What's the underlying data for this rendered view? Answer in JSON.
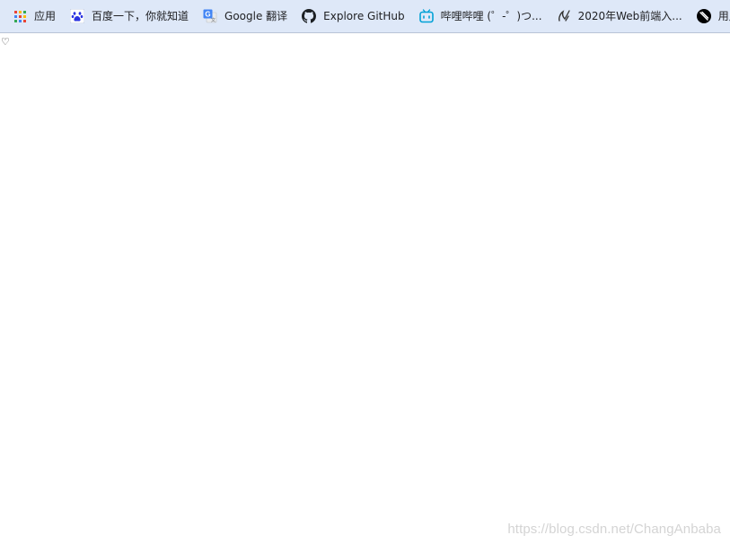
{
  "bookmarks": [
    {
      "label": "应用",
      "icon": "apps-grid-icon"
    },
    {
      "label": "百度一下，你就知道",
      "icon": "baidu-paw-icon"
    },
    {
      "label": "Google 翻译",
      "icon": "google-translate-icon"
    },
    {
      "label": "Explore GitHub",
      "icon": "github-icon"
    },
    {
      "label": "哔哩哔哩 (゜-゜)つ...",
      "icon": "bilibili-icon"
    },
    {
      "label": "2020年Web前端入...",
      "icon": "vue-script-icon"
    },
    {
      "label": "用户",
      "icon": "black-circle-icon"
    }
  ],
  "page": {
    "glyph": "♡"
  },
  "watermark": "https://blog.csdn.net/ChangAnbaba",
  "colors": {
    "bar_bg": "#dee8f8",
    "apps_dots": [
      "#ea4335",
      "#fbbc05",
      "#34a853",
      "#4285f4"
    ],
    "baidu": "#2932e1",
    "google_translate": "#4285f4",
    "bilibili": "#00a1d6"
  }
}
